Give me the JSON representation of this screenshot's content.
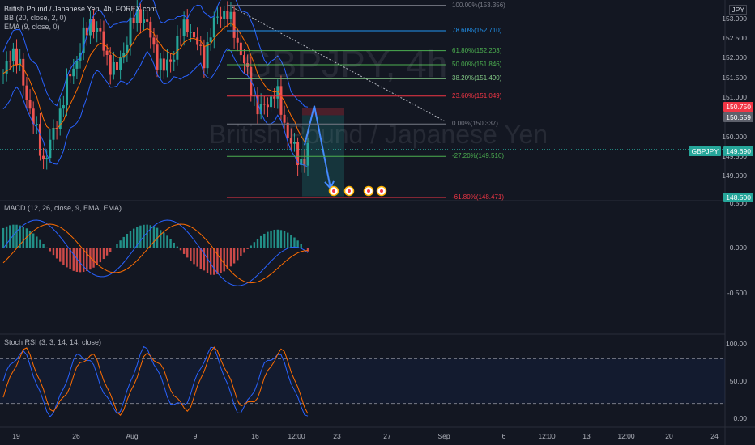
{
  "legend": {
    "title": "British Pound / Japanese Yen, 4h, FOREX.com",
    "bb": "BB (20, close, 2, 0)",
    "ema": "EMA (9, close, 0)",
    "macd": "MACD (12, 26, close, 9, EMA, EMA)",
    "stoch": "Stoch RSI (3, 3, 14, 14, close)"
  },
  "watermark": {
    "symbol": "GBPJPY, 4h",
    "name": "British Pound / Japanese Yen"
  },
  "currency": "JPY",
  "price_axis": [
    "153.000",
    "152.500",
    "152.000",
    "151.500",
    "151.000",
    "150.000",
    "149.500",
    "149.000"
  ],
  "macd_axis": [
    "0.500",
    "0.000",
    "-0.500"
  ],
  "rsi_axis": [
    "100.00",
    "50.00",
    "0.00"
  ],
  "time_axis": [
    "19",
    "26",
    "Aug",
    "9",
    "16",
    "12:00",
    "23",
    "27",
    "Sep",
    "6",
    "12:00",
    "13",
    "12:00",
    "20",
    "24"
  ],
  "tags": {
    "symbol": "GBPJPY",
    "last": "149.690",
    "red": "150.750",
    "gray": "150.559",
    "teal": "148.500"
  },
  "fib_levels": [
    {
      "label": "100.00%(153.356)",
      "price": 153.356,
      "color": "#787b86"
    },
    {
      "label": "78.60%(152.710)",
      "price": 152.71,
      "color": "#2196f3"
    },
    {
      "label": "61.80%(152.203)",
      "price": 152.203,
      "color": "#4caf50"
    },
    {
      "label": "50.00%(151.846)",
      "price": 151.846,
      "color": "#4caf50"
    },
    {
      "label": "38.20%(151.490)",
      "price": 151.49,
      "color": "#81c784"
    },
    {
      "label": "23.60%(151.049)",
      "price": 151.049,
      "color": "#f23645"
    },
    {
      "label": "0.00%(150.337)",
      "price": 150.337,
      "color": "#787b86"
    },
    {
      "label": "-27.20%(149.516)",
      "price": 149.516,
      "color": "#4caf50"
    },
    {
      "label": "-61.80%(148.471)",
      "price": 148.471,
      "color": "#f23645"
    }
  ],
  "colors": {
    "bg": "#131722",
    "up": "#26a69a",
    "down": "#ef5350",
    "bb": "#2962ff",
    "ema": "#ff6d00",
    "macd": "#2962ff",
    "signal": "#ff6d00",
    "k": "#2962ff",
    "d": "#ff6d00"
  },
  "chart_data": {
    "type": "candlestick",
    "symbol": "GBPJPY",
    "interval": "4h",
    "ylim": [
      148.45,
      153.45
    ],
    "close": [
      151.5,
      152.3,
      151.8,
      151.0,
      150.2,
      149.4,
      149.9,
      150.6,
      151.4,
      151.9,
      152.5,
      153.0,
      152.6,
      152.0,
      151.6,
      152.2,
      152.9,
      153.2,
      152.8,
      152.1,
      151.7,
      152.0,
      152.6,
      152.9,
      152.4,
      152.0,
      152.7,
      153.2,
      153.1,
      152.6,
      151.9,
      151.2,
      150.6,
      150.9,
      151.2,
      150.4,
      149.8,
      149.3,
      149.69
    ],
    "macd": {
      "ylim": [
        -0.75,
        0.55
      ]
    },
    "stoch_rsi": {
      "ylim": [
        0,
        100
      ],
      "bands": [
        20,
        80
      ]
    }
  }
}
